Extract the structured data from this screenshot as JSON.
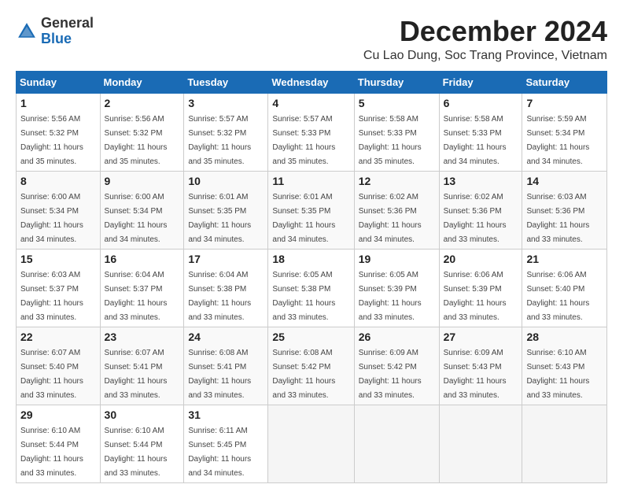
{
  "header": {
    "logo_general": "General",
    "logo_blue": "Blue",
    "title": "December 2024",
    "subtitle": "Cu Lao Dung, Soc Trang Province, Vietnam"
  },
  "columns": [
    "Sunday",
    "Monday",
    "Tuesday",
    "Wednesday",
    "Thursday",
    "Friday",
    "Saturday"
  ],
  "weeks": [
    [
      {
        "day": "1",
        "info": "Sunrise: 5:56 AM\nSunset: 5:32 PM\nDaylight: 11 hours\nand 35 minutes."
      },
      {
        "day": "2",
        "info": "Sunrise: 5:56 AM\nSunset: 5:32 PM\nDaylight: 11 hours\nand 35 minutes."
      },
      {
        "day": "3",
        "info": "Sunrise: 5:57 AM\nSunset: 5:32 PM\nDaylight: 11 hours\nand 35 minutes."
      },
      {
        "day": "4",
        "info": "Sunrise: 5:57 AM\nSunset: 5:33 PM\nDaylight: 11 hours\nand 35 minutes."
      },
      {
        "day": "5",
        "info": "Sunrise: 5:58 AM\nSunset: 5:33 PM\nDaylight: 11 hours\nand 35 minutes."
      },
      {
        "day": "6",
        "info": "Sunrise: 5:58 AM\nSunset: 5:33 PM\nDaylight: 11 hours\nand 34 minutes."
      },
      {
        "day": "7",
        "info": "Sunrise: 5:59 AM\nSunset: 5:34 PM\nDaylight: 11 hours\nand 34 minutes."
      }
    ],
    [
      {
        "day": "8",
        "info": "Sunrise: 6:00 AM\nSunset: 5:34 PM\nDaylight: 11 hours\nand 34 minutes."
      },
      {
        "day": "9",
        "info": "Sunrise: 6:00 AM\nSunset: 5:34 PM\nDaylight: 11 hours\nand 34 minutes."
      },
      {
        "day": "10",
        "info": "Sunrise: 6:01 AM\nSunset: 5:35 PM\nDaylight: 11 hours\nand 34 minutes."
      },
      {
        "day": "11",
        "info": "Sunrise: 6:01 AM\nSunset: 5:35 PM\nDaylight: 11 hours\nand 34 minutes."
      },
      {
        "day": "12",
        "info": "Sunrise: 6:02 AM\nSunset: 5:36 PM\nDaylight: 11 hours\nand 34 minutes."
      },
      {
        "day": "13",
        "info": "Sunrise: 6:02 AM\nSunset: 5:36 PM\nDaylight: 11 hours\nand 33 minutes."
      },
      {
        "day": "14",
        "info": "Sunrise: 6:03 AM\nSunset: 5:36 PM\nDaylight: 11 hours\nand 33 minutes."
      }
    ],
    [
      {
        "day": "15",
        "info": "Sunrise: 6:03 AM\nSunset: 5:37 PM\nDaylight: 11 hours\nand 33 minutes."
      },
      {
        "day": "16",
        "info": "Sunrise: 6:04 AM\nSunset: 5:37 PM\nDaylight: 11 hours\nand 33 minutes."
      },
      {
        "day": "17",
        "info": "Sunrise: 6:04 AM\nSunset: 5:38 PM\nDaylight: 11 hours\nand 33 minutes."
      },
      {
        "day": "18",
        "info": "Sunrise: 6:05 AM\nSunset: 5:38 PM\nDaylight: 11 hours\nand 33 minutes."
      },
      {
        "day": "19",
        "info": "Sunrise: 6:05 AM\nSunset: 5:39 PM\nDaylight: 11 hours\nand 33 minutes."
      },
      {
        "day": "20",
        "info": "Sunrise: 6:06 AM\nSunset: 5:39 PM\nDaylight: 11 hours\nand 33 minutes."
      },
      {
        "day": "21",
        "info": "Sunrise: 6:06 AM\nSunset: 5:40 PM\nDaylight: 11 hours\nand 33 minutes."
      }
    ],
    [
      {
        "day": "22",
        "info": "Sunrise: 6:07 AM\nSunset: 5:40 PM\nDaylight: 11 hours\nand 33 minutes."
      },
      {
        "day": "23",
        "info": "Sunrise: 6:07 AM\nSunset: 5:41 PM\nDaylight: 11 hours\nand 33 minutes."
      },
      {
        "day": "24",
        "info": "Sunrise: 6:08 AM\nSunset: 5:41 PM\nDaylight: 11 hours\nand 33 minutes."
      },
      {
        "day": "25",
        "info": "Sunrise: 6:08 AM\nSunset: 5:42 PM\nDaylight: 11 hours\nand 33 minutes."
      },
      {
        "day": "26",
        "info": "Sunrise: 6:09 AM\nSunset: 5:42 PM\nDaylight: 11 hours\nand 33 minutes."
      },
      {
        "day": "27",
        "info": "Sunrise: 6:09 AM\nSunset: 5:43 PM\nDaylight: 11 hours\nand 33 minutes."
      },
      {
        "day": "28",
        "info": "Sunrise: 6:10 AM\nSunset: 5:43 PM\nDaylight: 11 hours\nand 33 minutes."
      }
    ],
    [
      {
        "day": "29",
        "info": "Sunrise: 6:10 AM\nSunset: 5:44 PM\nDaylight: 11 hours\nand 33 minutes."
      },
      {
        "day": "30",
        "info": "Sunrise: 6:10 AM\nSunset: 5:44 PM\nDaylight: 11 hours\nand 33 minutes."
      },
      {
        "day": "31",
        "info": "Sunrise: 6:11 AM\nSunset: 5:45 PM\nDaylight: 11 hours\nand 34 minutes."
      },
      {
        "day": "",
        "info": ""
      },
      {
        "day": "",
        "info": ""
      },
      {
        "day": "",
        "info": ""
      },
      {
        "day": "",
        "info": ""
      }
    ]
  ]
}
